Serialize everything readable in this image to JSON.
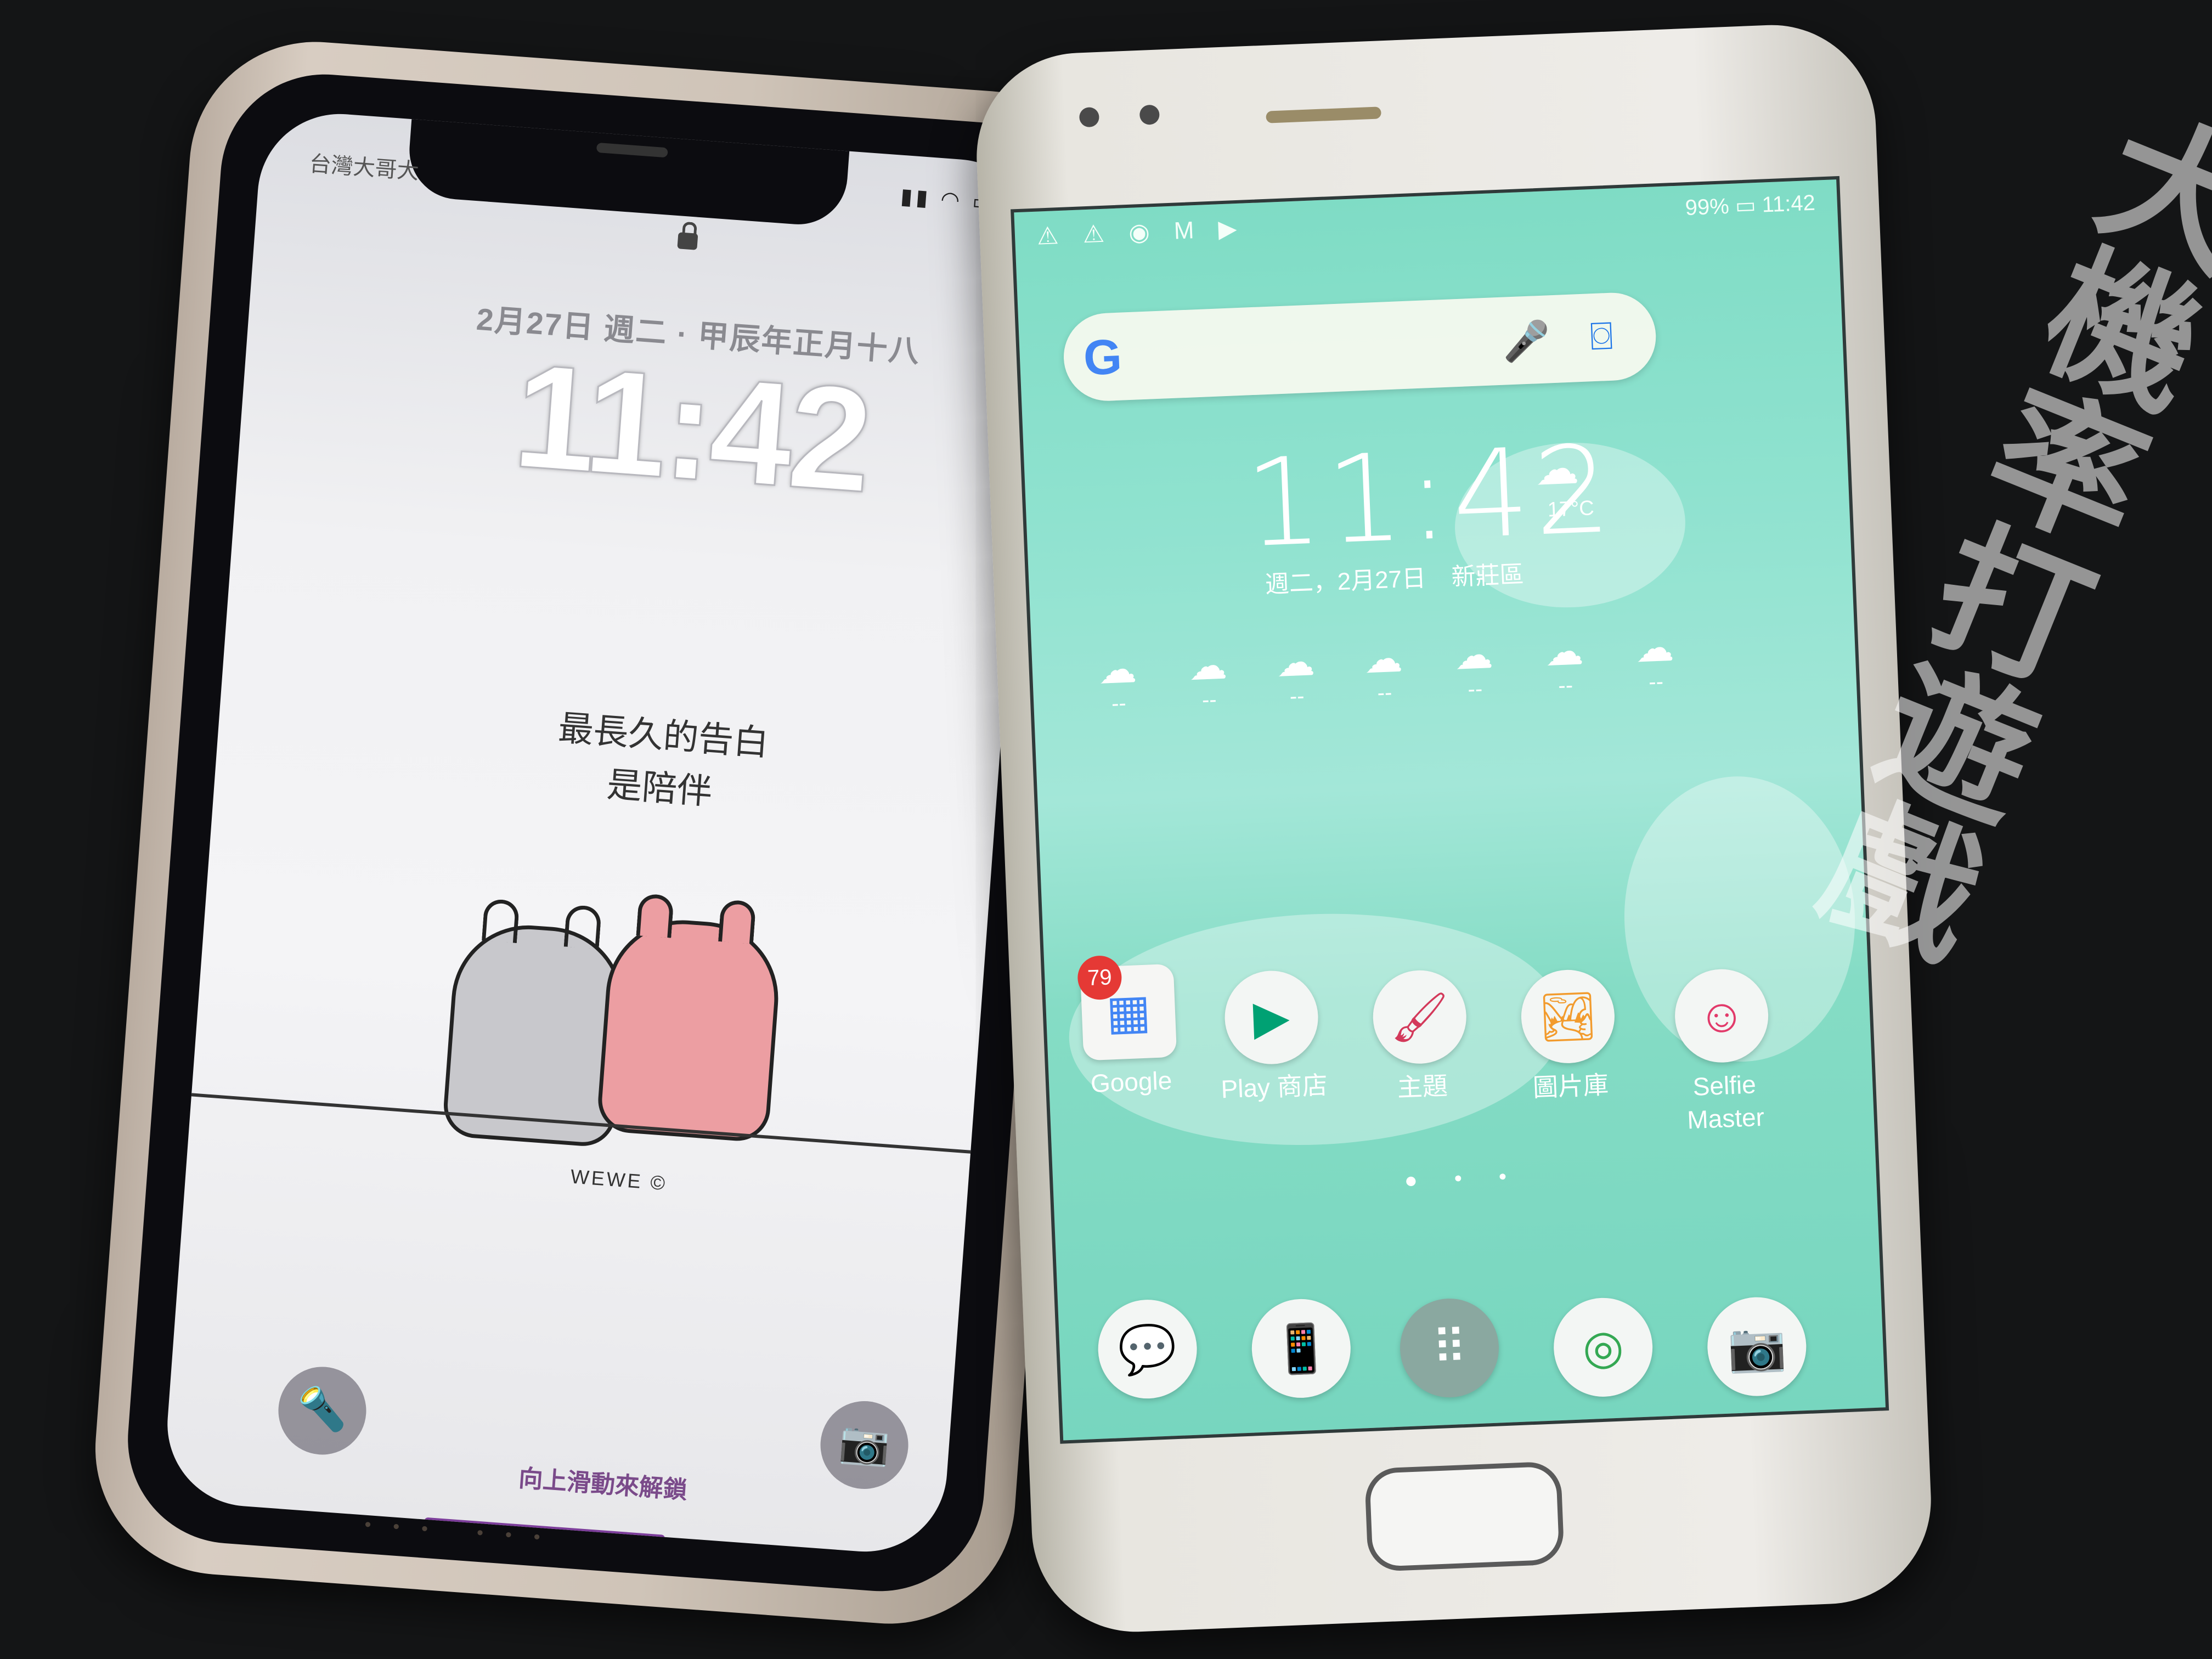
{
  "iphone": {
    "carrier": "台灣大哥大",
    "status_icons": "▮▮ ◠ ▭",
    "date": "2月27日 週二 · 甲辰年正月十八",
    "time": "11:42",
    "quote_line1": "最長久的告白",
    "quote_line2": "是陪伴",
    "credit": "WEWE ©",
    "flashlight_icon": "flashlight-icon",
    "flashlight_glyph": "🔦",
    "camera_icon": "camera-icon",
    "camera_glyph": "📷",
    "unlock_hint": "向上滑動來解鎖"
  },
  "android": {
    "status_left": "⚠ ⚠ ◉ M ▶",
    "status_right": "99% ▭ 11:42",
    "search": {
      "logo": "G",
      "mic": "🎤",
      "lens": "⌼"
    },
    "clock": {
      "time": "11:42",
      "weather_glyph": "☁",
      "temperature": "17°C",
      "date": "週二，2月27日",
      "location": "新莊區"
    },
    "forecast": [
      {
        "glyph": "☁",
        "value": "--"
      },
      {
        "glyph": "☁",
        "value": "--"
      },
      {
        "glyph": "☁",
        "value": "--"
      },
      {
        "glyph": "☁",
        "value": "--"
      },
      {
        "glyph": "☁",
        "value": "--"
      },
      {
        "glyph": "☁",
        "value": "--"
      },
      {
        "glyph": "☁",
        "value": "--"
      }
    ],
    "apps": [
      {
        "label": "Google",
        "glyph": "▦",
        "badge": "79"
      },
      {
        "label": "Play 商店",
        "glyph": "▶"
      },
      {
        "label": "主題",
        "glyph": "🖌"
      },
      {
        "label": "圖片庫",
        "glyph": "🏞"
      },
      {
        "label": "Selfie Master",
        "glyph": "☺"
      }
    ],
    "page_indicator": "● • •",
    "dock": [
      {
        "name": "messages",
        "glyph": "💬"
      },
      {
        "name": "phone",
        "glyph": "📱"
      },
      {
        "name": "app-drawer",
        "glyph": "⠿"
      },
      {
        "name": "chrome",
        "glyph": "◎"
      },
      {
        "name": "camera",
        "glyph": "📷"
      }
    ]
  },
  "watermark": "大機率打遊戲",
  "colors": {
    "android_wallpaper": "#8fe2cf",
    "unlock_accent": "#7d3e9b"
  }
}
